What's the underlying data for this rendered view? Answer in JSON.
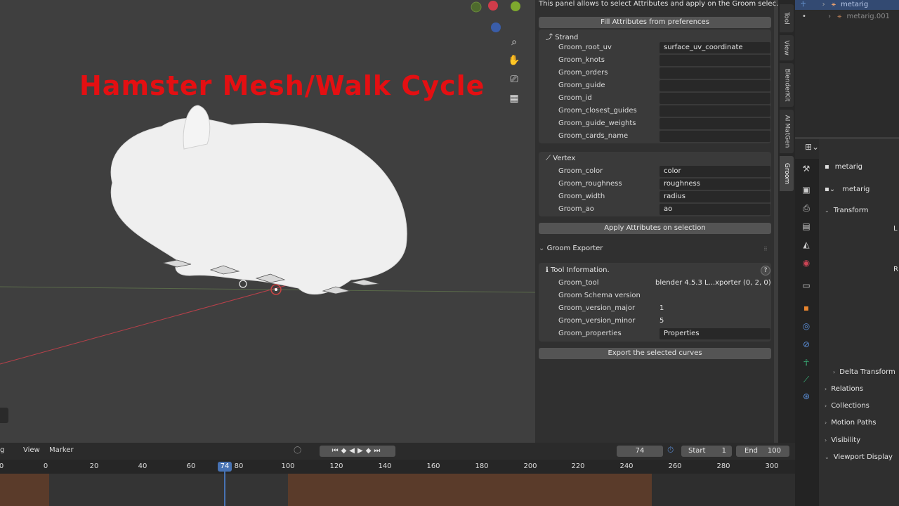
{
  "viewport": {
    "overlay_title": "Hamster Mesh/Walk Cycle",
    "nav_icons": [
      "zoom-icon",
      "hand-icon",
      "camera-icon",
      "grid-icon"
    ]
  },
  "npanel": {
    "info_text": "This panel allows to select Attributes and apply on the Groom selec...",
    "fill_button": "Fill Attributes from preferences",
    "strand": {
      "header": "Strand",
      "rows": [
        {
          "label": "Groom_root_uv",
          "value": "surface_uv_coordinate"
        },
        {
          "label": "Groom_knots",
          "value": ""
        },
        {
          "label": "Groom_orders",
          "value": ""
        },
        {
          "label": "Groom_guide",
          "value": ""
        },
        {
          "label": "Groom_id",
          "value": ""
        },
        {
          "label": "Groom_closest_guides",
          "value": ""
        },
        {
          "label": "Groom_guide_weights",
          "value": ""
        },
        {
          "label": "Groom_cards_name",
          "value": ""
        }
      ]
    },
    "vertex": {
      "header": "Vertex",
      "rows": [
        {
          "label": "Groom_color",
          "value": "color"
        },
        {
          "label": "Groom_roughness",
          "value": "roughness"
        },
        {
          "label": "Groom_width",
          "value": "radius"
        },
        {
          "label": "Groom_ao",
          "value": "ao"
        }
      ]
    },
    "apply_button": "Apply Attributes on selection",
    "exporter": {
      "header": "Groom Exporter",
      "tool_info": "Tool Information.",
      "help": "?",
      "rows": [
        {
          "label": "Groom_tool",
          "value": "blender 4.5.3 L...xporter (0, 2, 0)"
        },
        {
          "label": "Groom Schema version",
          "value": ""
        },
        {
          "label": "Groom_version_major",
          "value": "1"
        },
        {
          "label": "Groom_version_minor",
          "value": "5"
        },
        {
          "label": "Groom_properties",
          "value": "Properties"
        }
      ]
    },
    "export_button": "Export the selected curves"
  },
  "vtabs": [
    "Tool",
    "View",
    "BlenderKit",
    "AI MatGen",
    "Groom"
  ],
  "outliner": {
    "items": [
      "metarig",
      "metarig.001"
    ]
  },
  "properties": {
    "object_name": "metarig",
    "data_name": "metarig",
    "sections": [
      "Transform",
      "Delta Transform",
      "Relations",
      "Collections",
      "Motion Paths",
      "Visibility",
      "Viewport Display"
    ],
    "clipped_letters": [
      "L",
      "R"
    ]
  },
  "timeline": {
    "menu_left": "g",
    "menu_view": "View",
    "menu_marker": "Marker",
    "current_frame": "74",
    "start_label": "Start",
    "start_value": "1",
    "end_label": "End",
    "end_value": "100",
    "ticks": [
      "0",
      "0",
      "20",
      "40",
      "60",
      "80",
      "100",
      "120",
      "140",
      "160",
      "180",
      "200",
      "220",
      "240",
      "260",
      "280",
      "300"
    ],
    "playhead_label": "74"
  },
  "colors": {
    "title_red": "#e40f12",
    "accent_blue": "#4772b3",
    "timeline_orange": "#5a3b2a"
  }
}
